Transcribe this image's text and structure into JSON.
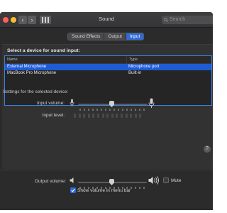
{
  "window": {
    "title": "Sound",
    "search_placeholder": "Search"
  },
  "tabs": [
    {
      "label": "Sound Effects",
      "active": false
    },
    {
      "label": "Output",
      "active": false
    },
    {
      "label": "Input",
      "active": true
    }
  ],
  "input": {
    "section_heading": "Select a device for sound input:",
    "columns": [
      "Name",
      "Type"
    ],
    "devices": [
      {
        "name": "External Microphone",
        "type": "Microphone port",
        "selected": true
      },
      {
        "name": "MacBook Pro Microphone",
        "type": "Built-in",
        "selected": false
      }
    ],
    "settings_label": "Settings for the selected device:",
    "input_volume_label": "Input volume:",
    "input_volume": 0.5,
    "input_level_label": "Input level:",
    "input_level": 0
  },
  "output": {
    "output_volume_label": "Output volume:",
    "output_volume": 0.5,
    "mute_label": "Mute",
    "mute_checked": false,
    "show_volume_label": "Show volume in menu bar",
    "show_volume_checked": true
  },
  "help_label": "?",
  "colors": {
    "accent": "#2f6bd6",
    "selection": "#1f5bd3",
    "close": "#ff5f57",
    "minimize": "#febc2e"
  }
}
